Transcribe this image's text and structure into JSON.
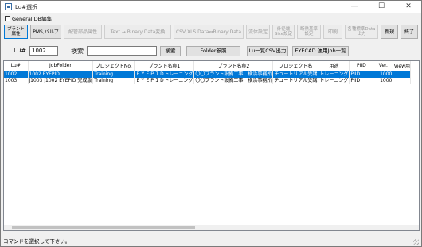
{
  "window": {
    "title": "Lu#選択",
    "minimize_glyph": "—",
    "maximize_glyph": "☐",
    "close_glyph": "✕"
  },
  "general_db": {
    "label": "General DB編集",
    "checked": false
  },
  "toolbar": {
    "plant_attr": "プラント属性",
    "pms_valve": "PMS,バルブ",
    "piping_attr": "配管部品属性",
    "text_binary": "Text → Binary Data変換",
    "csv_xls": "CSV,XLS Data⇔Binary Data",
    "flow_setting": "流体設定",
    "outer_diameter": "外径端 Size設定",
    "insulation": "断熱基準 設定",
    "print": "印刷",
    "standard_output": "各種標準Data 出力",
    "new": "新規",
    "exit": "終了"
  },
  "filter": {
    "lu_label": "Lu#",
    "lu_value": "1002",
    "search_label": "検索",
    "search_value": "",
    "search_button": "検索",
    "folder_button": "Folder参照",
    "csv_button": "Lu一覧CSV出力",
    "eyecad_button": "EYECAD 運用Job一覧"
  },
  "table": {
    "columns": [
      "Lu#",
      "JobFolder",
      "プロジェクトNo.",
      "プラント名称1",
      "プラント名称2",
      "プロジェクト名",
      "用途",
      "PIID",
      "Ver.",
      "View用"
    ],
    "rows": [
      [
        "1002",
        "1002 EYEPID",
        "Training",
        "ＥＹＥＰＩＤトレーニング",
        "〇〇プラント設備工事　横浜事務所",
        "チュートリアル受講",
        "トレーニング",
        "PIID",
        "1000",
        ""
      ],
      [
        "1003",
        "j1003 j1002 EYEPID 完成版",
        "Training",
        "ＥＹＥＰＩＤトレーニング",
        "〇〇プラント設備工事　横浜事務所",
        "チュートリアル受講",
        "トレーニング",
        "PIID",
        "1000",
        ""
      ]
    ],
    "selected_row": 0
  },
  "status": {
    "text": "コマンドを選択して下さい。"
  },
  "colors": {
    "selection": "#0078d7",
    "window_bg": "#f0f0f0"
  }
}
